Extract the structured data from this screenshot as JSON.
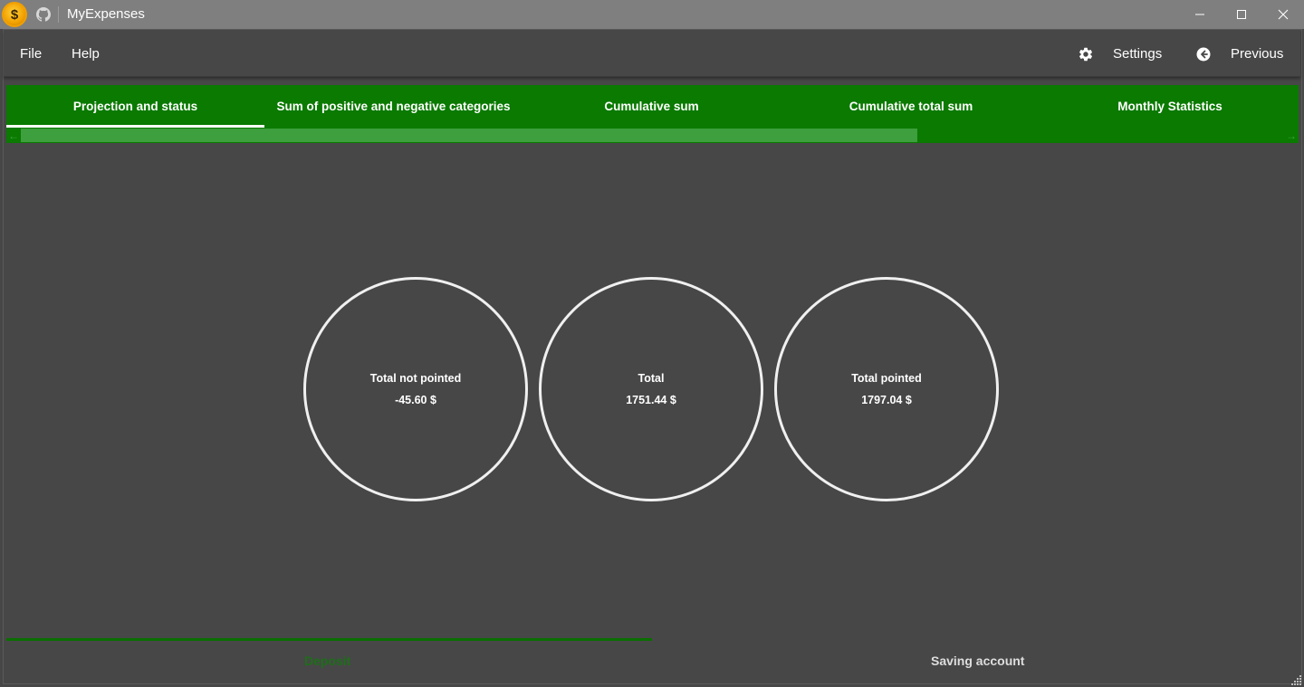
{
  "window": {
    "title": "MyExpenses",
    "icons": [
      "app-coin-icon",
      "github-icon",
      "minimize-icon",
      "maximize-icon",
      "close-icon"
    ]
  },
  "menu": {
    "file": "File",
    "help": "Help",
    "settings": "Settings",
    "previous": "Previous"
  },
  "tabs": [
    {
      "label": "Projection and status",
      "active": true
    },
    {
      "label": "Sum of positive and negative categories",
      "active": false
    },
    {
      "label": "Cumulative sum",
      "active": false
    },
    {
      "label": "Cumulative total sum",
      "active": false
    },
    {
      "label": "Monthly Statistics",
      "active": false
    }
  ],
  "tab_scroll": {
    "thumb_fraction": 0.71
  },
  "summary": [
    {
      "label": "Total not pointed",
      "value": "-45.60 $"
    },
    {
      "label": "Total",
      "value": "1751.44 $"
    },
    {
      "label": "Total pointed",
      "value": "1797.04 $"
    }
  ],
  "bottom_tabs": {
    "deposit": "Deposit",
    "saving": "Saving account"
  },
  "colors": {
    "accent": "#0a7a00",
    "background": "#474747",
    "titlebar": "#7f7f7f"
  }
}
